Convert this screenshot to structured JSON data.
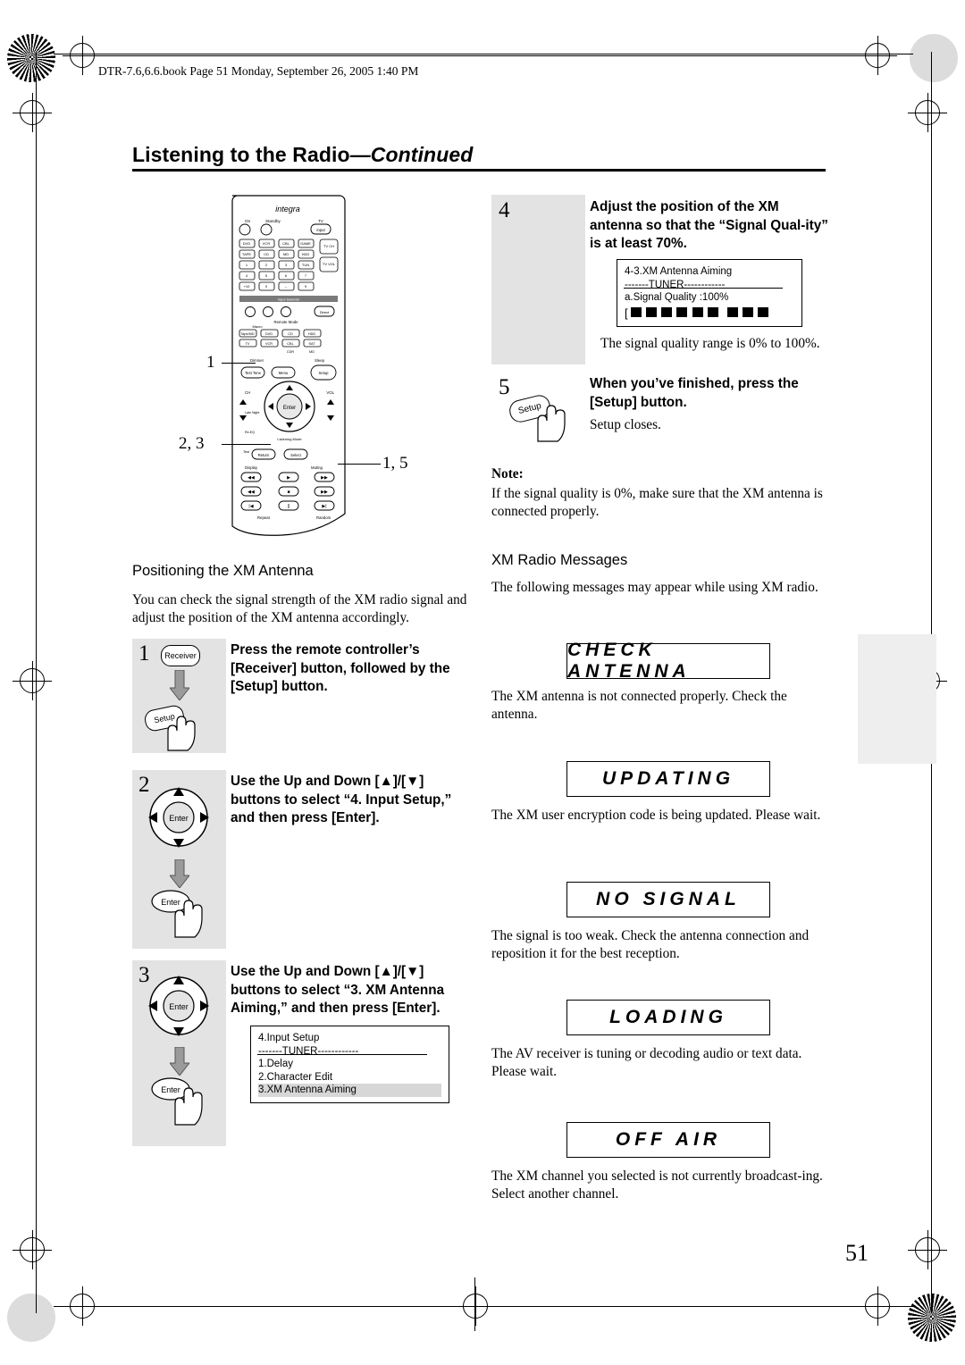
{
  "header": {
    "book_line": "DTR-7.6,6.6.book  Page 51  Monday, September 26, 2005  1:40 PM",
    "title_main": "Listening to the Radio",
    "title_cont": "—Continued"
  },
  "remote": {
    "brand": "integra",
    "labels": {
      "on": "On",
      "standby": "Standby",
      "tv": "TV",
      "input": "Input",
      "tvch": "TV CH",
      "tvvol": "TV VOL",
      "input_selector": "Input Selector",
      "remote_mode": "Remote Mode",
      "macro": "Macro",
      "dimmer": "Dimmer",
      "sleep": "Sleep",
      "display": "Display",
      "muting": "Muting",
      "enter": "Enter",
      "vol": "VOL",
      "ch": "CH",
      "setup": "Setup",
      "menu": "Menu",
      "random": "Random",
      "repeat": "Repeat",
      "return": "Return",
      "select": "Select",
      "test_tone": "Test Tone",
      "late_night": "Late Night",
      "re_eq": "Re-EQ",
      "listening_mode": "Listening Mode"
    },
    "keys_row1": [
      "DVD",
      "VCR",
      "CBL/SAT",
      "GAME"
    ],
    "keys_row2": [
      "TAPE",
      "DVD",
      "CD",
      "MD"
    ],
    "keys_numbers": [
      "1",
      "2",
      "3",
      "4",
      "5",
      "6",
      "7",
      "8",
      "9",
      "+10",
      "0",
      "--/---"
    ],
    "mode_keys": [
      "DVD",
      "VCR",
      "CBL/SAT",
      "GAME",
      "TAPE/MD",
      "CD",
      "HDD",
      "TV"
    ]
  },
  "callouts": {
    "c1": "1",
    "c23": "2, 3",
    "c15": "1, 5"
  },
  "left": {
    "section_head": "Positioning the XM Antenna",
    "intro": "You can check the signal strength of the XM radio signal and adjust the position of the XM antenna accordingly.",
    "steps": [
      {
        "num": "1",
        "instr": "Press the remote controller’s [Receiver] button, followed by the [Setup] button.",
        "btn_receiver": "Receiver",
        "btn_setup": "Setup"
      },
      {
        "num": "2",
        "instr": "Use the Up and Down [▲]/[▼] buttons to select “4. Input Setup,” and then press [Enter].",
        "btn_enter": "Enter"
      },
      {
        "num": "3",
        "instr": "Use the Up and Down [▲]/[▼] buttons to select “3. XM Antenna Aiming,” and then press [Enter].",
        "btn_enter": "Enter"
      }
    ],
    "osd": {
      "line1": "4.Input Setup",
      "line2": "-------TUNER------------",
      "line3": "1.Delay",
      "line4": "2.Character Edit",
      "line5": "3.XM Antenna Aiming"
    }
  },
  "right": {
    "steps": [
      {
        "num": "4",
        "instr": "Adjust the position of the XM antenna so that the “Signal Qual-ity” is at least 70%.",
        "caption": "The signal quality range is 0% to 100%."
      },
      {
        "num": "5",
        "instr": "When you’ve finished, press the [Setup] button.",
        "caption": "Setup closes.",
        "btn_setup": "Setup"
      }
    ],
    "osd": {
      "line1": "4-3.XM Antenna Aiming",
      "line2": "-------TUNER------------",
      "line3": "a.Signal Quality   :100%",
      "bracket": "[",
      "bars_solid": 6,
      "bars_trailing": 3
    },
    "note_head": "Note:",
    "note_body": "If the signal quality is 0%, make sure that the XM antenna is connected properly.",
    "messages_head": "XM Radio Messages",
    "messages_intro": "The following messages may appear while using XM radio.",
    "messages": [
      {
        "label": "CHECK ANTENNA",
        "desc": "The XM antenna is not connected properly. Check the antenna."
      },
      {
        "label": "UPDATING",
        "desc": "The XM user encryption code is being updated. Please wait."
      },
      {
        "label": "NO SIGNAL",
        "desc": "The signal is too weak. Check the antenna connection and reposition it for the best reception."
      },
      {
        "label": "LOADING",
        "desc": "The AV receiver is tuning or decoding audio or text data. Please wait."
      },
      {
        "label": "OFF AIR",
        "desc": "The XM channel you selected is not currently broadcast-ing. Select another channel."
      }
    ]
  },
  "page_number": "51"
}
